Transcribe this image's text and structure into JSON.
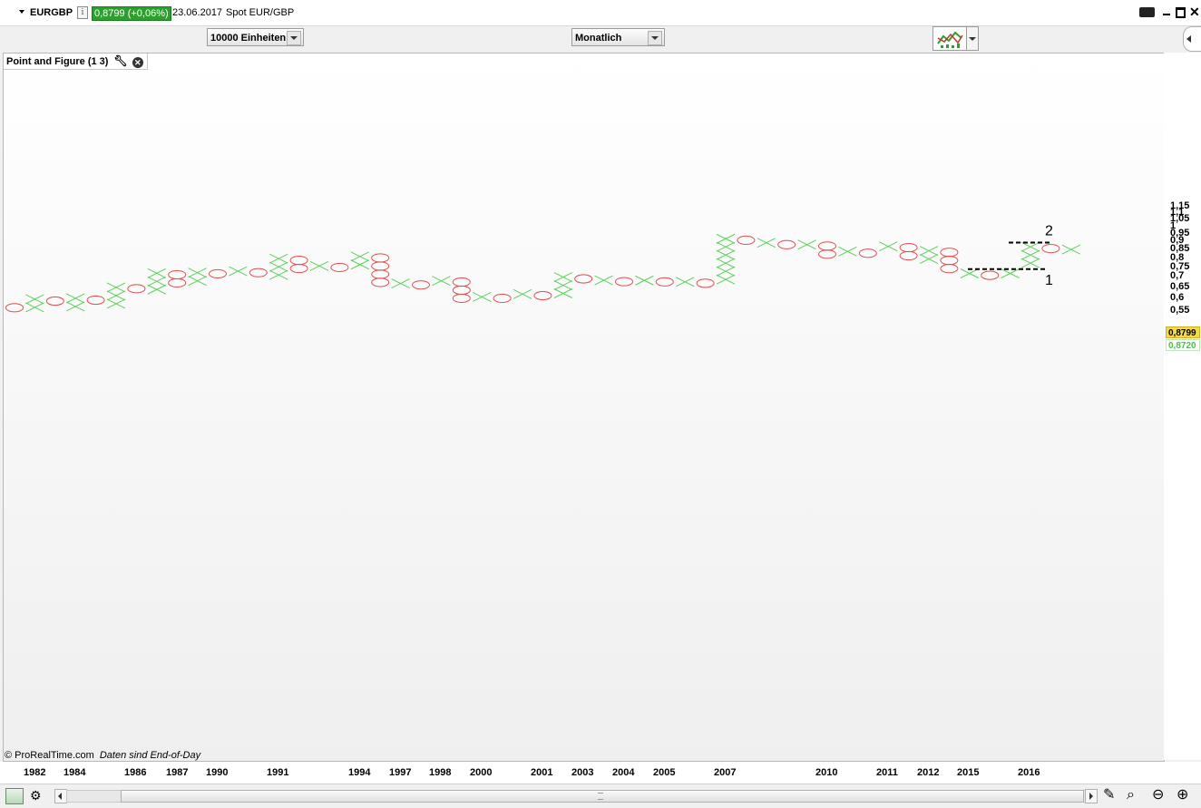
{
  "header": {
    "symbol": "EURGBP",
    "info_icon": "info-icon",
    "price_change": "0,8799 (+0,06%)",
    "date": "23.06.2017",
    "instrument": "Spot EUR/GBP"
  },
  "toolbar": {
    "box_size": "10000 Einheiten",
    "period": "Monatlich"
  },
  "indicator": {
    "label": "Point and Figure (1 3)"
  },
  "footer": {
    "copyright": "© ProRealTime.com",
    "note": "Daten sind End-of-Day"
  },
  "price_tags": {
    "last": "0,8799",
    "other": "0,8720"
  },
  "colors": {
    "x_mark": "#5ecf5e",
    "o_mark": "#e05050",
    "price_tag_bg": "#f6d84a",
    "change_bg": "#2ca02c"
  },
  "chart_data": {
    "type": "point-and-figure",
    "y_ticks": [
      "1,15",
      "1,1",
      "1,05",
      "1",
      "0,95",
      "0,9",
      "0,85",
      "0,8",
      "0,75",
      "0,7",
      "0,65",
      "0,6",
      "0,55"
    ],
    "x_labels": [
      "1982",
      "1984",
      "1986",
      "1987",
      "1990",
      "1991",
      "1994",
      "1997",
      "1998",
      "2000",
      "2001",
      "2003",
      "2004",
      "2005",
      "2007",
      "2010",
      "2011",
      "2012",
      "2015",
      "2016"
    ],
    "columns": [
      {
        "type": "O",
        "high": 0.578,
        "low": 0.546
      },
      {
        "type": "X",
        "high": 0.614,
        "low": 0.554
      },
      {
        "type": "O",
        "high": 0.606,
        "low": 0.56
      },
      {
        "type": "X",
        "high": 0.618,
        "low": 0.566
      },
      {
        "type": "O",
        "high": 0.61,
        "low": 0.563
      },
      {
        "type": "X",
        "high": 0.668,
        "low": 0.567
      },
      {
        "type": "O",
        "high": 0.662,
        "low": 0.625
      },
      {
        "type": "X",
        "high": 0.739,
        "low": 0.628
      },
      {
        "type": "O",
        "high": 0.731,
        "low": 0.642
      },
      {
        "type": "X",
        "high": 0.742,
        "low": 0.649
      },
      {
        "type": "O",
        "high": 0.736,
        "low": 0.721
      },
      {
        "type": "X",
        "high": 0.75,
        "low": 0.727
      },
      {
        "type": "O",
        "high": 0.742,
        "low": 0.698
      },
      {
        "type": "X",
        "high": 0.82,
        "low": 0.705
      },
      {
        "type": "O",
        "high": 0.81,
        "low": 0.741
      },
      {
        "type": "X",
        "high": 0.778,
        "low": 0.746
      },
      {
        "type": "O",
        "high": 0.77,
        "low": 0.755
      },
      {
        "type": "X",
        "high": 0.833,
        "low": 0.763
      },
      {
        "type": "O",
        "high": 0.824,
        "low": 0.653
      },
      {
        "type": "X",
        "high": 0.687,
        "low": 0.66
      },
      {
        "type": "O",
        "high": 0.68,
        "low": 0.651
      },
      {
        "type": "X",
        "high": 0.7,
        "low": 0.656
      },
      {
        "type": "O",
        "high": 0.694,
        "low": 0.589
      },
      {
        "type": "X",
        "high": 0.624,
        "low": 0.595
      },
      {
        "type": "O",
        "high": 0.618,
        "low": 0.588
      },
      {
        "type": "X",
        "high": 0.637,
        "low": 0.593
      },
      {
        "type": "O",
        "high": 0.63,
        "low": 0.601
      },
      {
        "type": "X",
        "high": 0.719,
        "low": 0.603
      },
      {
        "type": "O",
        "high": 0.71,
        "low": 0.685
      },
      {
        "type": "X",
        "high": 0.703,
        "low": 0.689
      },
      {
        "type": "O",
        "high": 0.696,
        "low": 0.662
      },
      {
        "type": "X",
        "high": 0.702,
        "low": 0.667
      },
      {
        "type": "O",
        "high": 0.695,
        "low": 0.674
      },
      {
        "type": "X",
        "high": 0.695,
        "low": 0.68
      },
      {
        "type": "O",
        "high": 0.688,
        "low": 0.667
      },
      {
        "type": "X",
        "high": 0.945,
        "low": 0.672
      },
      {
        "type": "O",
        "high": 0.935,
        "low": 0.889
      },
      {
        "type": "X",
        "high": 0.918,
        "low": 0.898
      },
      {
        "type": "O",
        "high": 0.906,
        "low": 0.852
      },
      {
        "type": "X",
        "high": 0.906,
        "low": 0.86
      },
      {
        "type": "O",
        "high": 0.897,
        "low": 0.816
      },
      {
        "type": "X",
        "high": 0.863,
        "low": 0.823
      },
      {
        "type": "O",
        "high": 0.852,
        "low": 0.83
      },
      {
        "type": "X",
        "high": 0.895,
        "low": 0.839
      },
      {
        "type": "O",
        "high": 0.887,
        "low": 0.782
      },
      {
        "type": "X",
        "high": 0.867,
        "low": 0.79
      },
      {
        "type": "O",
        "high": 0.858,
        "low": 0.706
      },
      {
        "type": "X",
        "high": 0.738,
        "low": 0.714
      },
      {
        "type": "O",
        "high": 0.728,
        "low": 0.705
      },
      {
        "type": "X",
        "high": 0.738,
        "low": 0.71
      },
      {
        "type": "X",
        "high": 0.892,
        "low": 0.745
      },
      {
        "type": "O",
        "high": 0.881,
        "low": 0.841
      },
      {
        "type": "X",
        "high": 0.875,
        "low": 0.848
      }
    ],
    "annotations": [
      {
        "label": "1",
        "y": 0.739
      },
      {
        "label": "2",
        "y": 0.893
      }
    ]
  }
}
